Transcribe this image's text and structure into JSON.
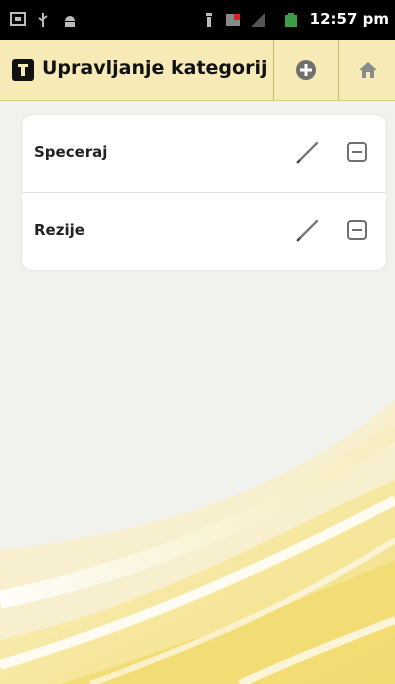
{
  "status_bar": {
    "time": "12:57 pm",
    "icons": [
      "notification-icon",
      "usb-icon",
      "android-icon",
      "wifi-icon",
      "flag-icon",
      "signal-icon",
      "battery-icon"
    ]
  },
  "action_bar": {
    "title": "Upravljanje kategorija",
    "logo_icon": "app-logo-icon",
    "add_icon": "add-circle-icon",
    "home_icon": "home-icon",
    "background_color": "#f6eab6"
  },
  "categories": [
    {
      "label": "Speceraj"
    },
    {
      "label": "Rezije"
    }
  ],
  "colors": {
    "accent_yellow": "#f4e07a",
    "card_background": "#ffffff"
  }
}
